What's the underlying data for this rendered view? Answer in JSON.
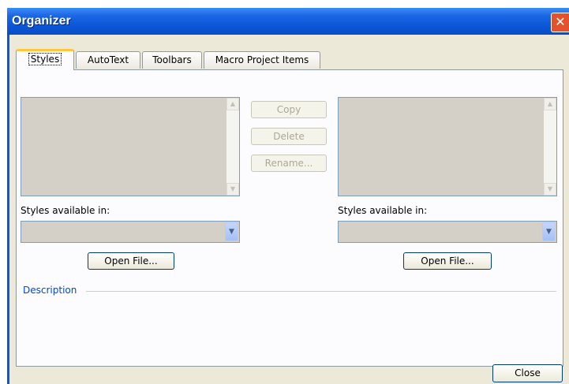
{
  "window": {
    "title": "Organizer"
  },
  "tabs": [
    {
      "label": "Styles",
      "active": true
    },
    {
      "label": "AutoText",
      "active": false
    },
    {
      "label": "Toolbars",
      "active": false
    },
    {
      "label": "Macro Project Items",
      "active": false
    }
  ],
  "left": {
    "available_label": "Styles available in:",
    "combo_value": "",
    "open_file": "Open File..."
  },
  "right": {
    "available_label": "Styles available in:",
    "combo_value": "",
    "open_file": "Open File..."
  },
  "middle": {
    "copy": "Copy",
    "delete": "Delete",
    "rename": "Rename..."
  },
  "description_label": "Description",
  "footer": {
    "close": "Close"
  },
  "colors": {
    "title_bar": "#0a57d8",
    "dialog_bg": "#ece9d8",
    "description_text": "#0046d5",
    "close_x": "#e3522f"
  },
  "icons": {
    "close": "close-x-icon",
    "dropdown": "chevron-down-icon",
    "scroll_up": "scroll-up-arrow-icon",
    "scroll_down": "scroll-down-arrow-icon"
  }
}
